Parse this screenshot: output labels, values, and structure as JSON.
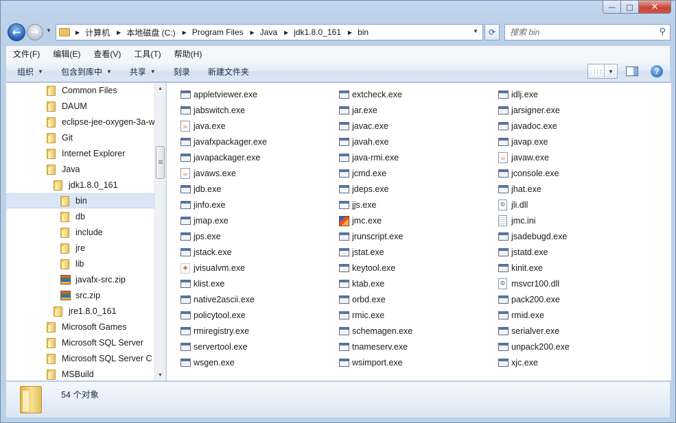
{
  "window": {
    "caption": {
      "minimize": "—",
      "maximize": "□",
      "close": "✕"
    }
  },
  "nav": {
    "back_glyph": "←",
    "forward_glyph": "→",
    "breadcrumb": [
      "计算机",
      "本地磁盘 (C:)",
      "Program Files",
      "Java",
      "jdk1.8.0_161",
      "bin"
    ],
    "refresh_glyph": "⟳",
    "search_placeholder": "搜索 bin"
  },
  "menubar": [
    "文件(F)",
    "编辑(E)",
    "查看(V)",
    "工具(T)",
    "帮助(H)"
  ],
  "toolbar": {
    "organize": "组织",
    "include_in_library": "包含到库中",
    "share": "共享",
    "burn": "刻录",
    "new_folder": "新建文件夹",
    "help_glyph": "?"
  },
  "tree": [
    {
      "label": "Common Files",
      "icon": "folder-icon",
      "indent": 0
    },
    {
      "label": "DAUM",
      "icon": "folder-icon",
      "indent": 0
    },
    {
      "label": "eclipse-jee-oxygen-3a-w",
      "icon": "folder-icon",
      "indent": 0
    },
    {
      "label": "Git",
      "icon": "folder-icon",
      "indent": 0
    },
    {
      "label": "Internet Explorer",
      "icon": "folder-icon",
      "indent": 0
    },
    {
      "label": "Java",
      "icon": "folder-icon",
      "indent": 0
    },
    {
      "label": "jdk1.8.0_161",
      "icon": "folder-icon",
      "indent": 1
    },
    {
      "label": "bin",
      "icon": "folder-icon",
      "indent": 2,
      "selected": true
    },
    {
      "label": "db",
      "icon": "folder-icon",
      "indent": 2
    },
    {
      "label": "include",
      "icon": "folder-icon",
      "indent": 2
    },
    {
      "label": "jre",
      "icon": "folder-icon",
      "indent": 2
    },
    {
      "label": "lib",
      "icon": "folder-icon",
      "indent": 2
    },
    {
      "label": "javafx-src.zip",
      "icon": "zip-icon",
      "indent": 2
    },
    {
      "label": "src.zip",
      "icon": "zip-icon",
      "indent": 2
    },
    {
      "label": "jre1.8.0_161",
      "icon": "folder-icon",
      "indent": 1
    },
    {
      "label": "Microsoft Games",
      "icon": "folder-icon",
      "indent": 0
    },
    {
      "label": "Microsoft SQL Server",
      "icon": "folder-icon",
      "indent": 0
    },
    {
      "label": "Microsoft SQL Server C",
      "icon": "folder-icon",
      "indent": 0
    },
    {
      "label": "MSBuild",
      "icon": "folder-icon",
      "indent": 0
    }
  ],
  "files": [
    {
      "name": "appletviewer.exe",
      "icon": "exe-icon"
    },
    {
      "name": "jabswitch.exe",
      "icon": "exe-icon"
    },
    {
      "name": "java.exe",
      "icon": "java-icon"
    },
    {
      "name": "javafxpackager.exe",
      "icon": "exe-icon"
    },
    {
      "name": "javapackager.exe",
      "icon": "exe-icon"
    },
    {
      "name": "javaws.exe",
      "icon": "java-icon"
    },
    {
      "name": "jdb.exe",
      "icon": "exe-icon"
    },
    {
      "name": "jinfo.exe",
      "icon": "exe-icon"
    },
    {
      "name": "jmap.exe",
      "icon": "exe-icon"
    },
    {
      "name": "jps.exe",
      "icon": "exe-icon"
    },
    {
      "name": "jstack.exe",
      "icon": "exe-icon"
    },
    {
      "name": "jvisualvm.exe",
      "icon": "jvisualvm-icon"
    },
    {
      "name": "klist.exe",
      "icon": "exe-icon"
    },
    {
      "name": "native2ascii.exe",
      "icon": "exe-icon"
    },
    {
      "name": "policytool.exe",
      "icon": "exe-icon"
    },
    {
      "name": "rmiregistry.exe",
      "icon": "exe-icon"
    },
    {
      "name": "servertool.exe",
      "icon": "exe-icon"
    },
    {
      "name": "wsgen.exe",
      "icon": "exe-icon"
    },
    {
      "name": "extcheck.exe",
      "icon": "exe-icon"
    },
    {
      "name": "jar.exe",
      "icon": "exe-icon"
    },
    {
      "name": "javac.exe",
      "icon": "exe-icon"
    },
    {
      "name": "javah.exe",
      "icon": "exe-icon"
    },
    {
      "name": "java-rmi.exe",
      "icon": "exe-icon"
    },
    {
      "name": "jcmd.exe",
      "icon": "exe-icon"
    },
    {
      "name": "jdeps.exe",
      "icon": "exe-icon"
    },
    {
      "name": "jjs.exe",
      "icon": "exe-icon"
    },
    {
      "name": "jmc.exe",
      "icon": "jmc-icon"
    },
    {
      "name": "jrunscript.exe",
      "icon": "exe-icon"
    },
    {
      "name": "jstat.exe",
      "icon": "exe-icon"
    },
    {
      "name": "keytool.exe",
      "icon": "exe-icon"
    },
    {
      "name": "ktab.exe",
      "icon": "exe-icon"
    },
    {
      "name": "orbd.exe",
      "icon": "exe-icon"
    },
    {
      "name": "rmic.exe",
      "icon": "exe-icon"
    },
    {
      "name": "schemagen.exe",
      "icon": "exe-icon"
    },
    {
      "name": "tnameserv.exe",
      "icon": "exe-icon"
    },
    {
      "name": "wsimport.exe",
      "icon": "exe-icon"
    },
    {
      "name": "idlj.exe",
      "icon": "exe-icon"
    },
    {
      "name": "jarsigner.exe",
      "icon": "exe-icon"
    },
    {
      "name": "javadoc.exe",
      "icon": "exe-icon"
    },
    {
      "name": "javap.exe",
      "icon": "exe-icon"
    },
    {
      "name": "javaw.exe",
      "icon": "java-icon"
    },
    {
      "name": "jconsole.exe",
      "icon": "exe-icon"
    },
    {
      "name": "jhat.exe",
      "icon": "exe-icon"
    },
    {
      "name": "jli.dll",
      "icon": "dll-icon"
    },
    {
      "name": "jmc.ini",
      "icon": "ini-icon"
    },
    {
      "name": "jsadebugd.exe",
      "icon": "exe-icon"
    },
    {
      "name": "jstatd.exe",
      "icon": "exe-icon"
    },
    {
      "name": "kinit.exe",
      "icon": "exe-icon"
    },
    {
      "name": "msvcr100.dll",
      "icon": "dll-icon"
    },
    {
      "name": "pack200.exe",
      "icon": "exe-icon"
    },
    {
      "name": "rmid.exe",
      "icon": "exe-icon"
    },
    {
      "name": "serialver.exe",
      "icon": "exe-icon"
    },
    {
      "name": "unpack200.exe",
      "icon": "exe-icon"
    },
    {
      "name": "xjc.exe",
      "icon": "exe-icon"
    }
  ],
  "status": {
    "count_text": "54 个对象"
  }
}
